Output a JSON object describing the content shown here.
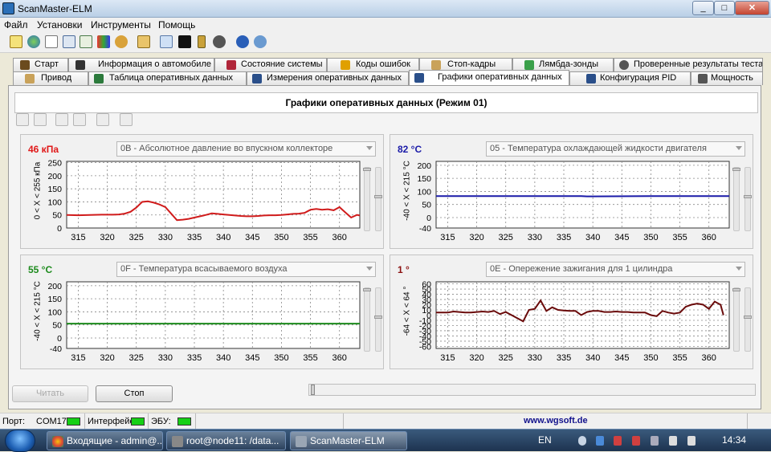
{
  "window": {
    "title": "ScanMaster-ELM",
    "min": "_",
    "max": "□",
    "close": "✕"
  },
  "menu": [
    "Файл",
    "Установки",
    "Инструменты",
    "Помощь"
  ],
  "toolbar_icons": [
    "connect-icon",
    "globe-icon",
    "document-icon",
    "grid-icon",
    "table-icon",
    "chart-icon",
    "settings-icon",
    "clipboard-icon",
    "chat-icon",
    "terminal-icon",
    "battery-icon",
    "record-icon",
    "info-icon",
    "help-icon"
  ],
  "tabs_row1": [
    {
      "label": "Старт",
      "icon_color": "#6b4b1e"
    },
    {
      "label": "Информация о автомобиле",
      "icon_color": "#333333"
    },
    {
      "label": "Состояние системы",
      "icon_color": "#b0263a"
    },
    {
      "label": "Коды ошибок",
      "icon_color": "#e0a000"
    },
    {
      "label": "Стоп-кадры",
      "icon_color": "#c9a25a"
    },
    {
      "label": "Лямбда-зонды",
      "icon_color": "#3aa04a"
    },
    {
      "label": "Проверенные результаты теста",
      "icon_color": "#555555"
    }
  ],
  "tabs_row2": [
    {
      "label": "Привод",
      "icon_color": "#c9a25a"
    },
    {
      "label": "Таблица оперативных данных",
      "icon_color": "#2c7a3c"
    },
    {
      "label": "Измерения оперативных данных",
      "icon_color": "#2a4f8a"
    },
    {
      "label": "Графики оперативных данных",
      "icon_color": "#2a4f8a"
    },
    {
      "label": "Конфигурация PID",
      "icon_color": "#2a4f8a"
    },
    {
      "label": "Мощность",
      "icon_color": "#555555"
    }
  ],
  "panel": {
    "title": "Графики оперативных данных (Режим 01)"
  },
  "panel_tools": [
    "add-graph-icon",
    "remove-graph-icon",
    "open-icon",
    "save-icon",
    "print-icon",
    "print-preview-icon"
  ],
  "graphs": [
    {
      "value": "46 кПа",
      "value_color": "#e01818",
      "pid": "0B - Абсолютное давление во впускном коллекторе",
      "unit": "0  < X <  255 кПа",
      "line_color": "#d01c1c",
      "y_ticks": [
        250,
        200,
        150,
        100,
        50,
        0
      ],
      "ymin": 0,
      "ymax": 255,
      "x_ticks": [
        315,
        320,
        325,
        330,
        335,
        340,
        345,
        350,
        355,
        360
      ],
      "x": [
        313,
        315,
        317,
        319,
        321,
        322,
        323,
        324,
        325,
        326,
        327,
        328,
        329,
        330,
        331,
        332,
        333,
        334,
        335,
        336,
        337,
        338,
        339,
        340,
        341,
        342,
        343,
        344,
        345,
        346,
        347,
        348,
        349,
        350,
        351,
        352,
        353,
        354,
        355,
        356,
        357,
        358,
        359,
        360,
        361,
        362,
        363,
        363.5
      ],
      "y": [
        50,
        49,
        50,
        51,
        51,
        52,
        55,
        62,
        78,
        100,
        102,
        97,
        90,
        80,
        55,
        30,
        32,
        35,
        40,
        45,
        50,
        56,
        54,
        52,
        50,
        48,
        46,
        45,
        45,
        46,
        48,
        49,
        49,
        50,
        52,
        54,
        55,
        58,
        70,
        73,
        70,
        72,
        68,
        80,
        60,
        40,
        50,
        48
      ]
    },
    {
      "value": "82 °C",
      "value_color": "#1a1aa8",
      "pid": "05 - Температура охлаждающей жидкости двигателя",
      "unit": "-40  < X <  215 °C",
      "line_color": "#1a1aa8",
      "y_ticks": [
        200,
        150,
        100,
        50,
        0,
        -40
      ],
      "ymin": -40,
      "ymax": 215,
      "x_ticks": [
        315,
        320,
        325,
        330,
        335,
        340,
        345,
        350,
        355,
        360
      ],
      "x": [
        313,
        320,
        330,
        338,
        339,
        340,
        350,
        360,
        363.5
      ],
      "y": [
        82,
        82,
        82,
        82,
        81,
        81,
        82,
        82,
        82
      ]
    },
    {
      "value": "55 °C",
      "value_color": "#1c8a1c",
      "pid": "0F - Температура всасываемого воздуха",
      "unit": "-40  < X <  215 °C",
      "line_color": "#1c8a1c",
      "y_ticks": [
        200,
        150,
        100,
        50,
        0,
        -40
      ],
      "ymin": -40,
      "ymax": 215,
      "x_ticks": [
        315,
        320,
        325,
        330,
        335,
        340,
        345,
        350,
        355,
        360
      ],
      "x": [
        313,
        330,
        350,
        363.5
      ],
      "y": [
        55,
        55,
        55,
        55
      ]
    },
    {
      "value": "1 °",
      "value_color": "#8b1010",
      "pid": "0E - Опережение зажигания для 1 цилиндра",
      "unit": "-64  < X <  64 °",
      "line_color": "#6a0a0a",
      "y_ticks": [
        60,
        50,
        40,
        30,
        20,
        10,
        0,
        -10,
        -20,
        -30,
        -40,
        -50,
        -60
      ],
      "ymin": -64,
      "ymax": 64,
      "x_ticks": [
        315,
        320,
        325,
        330,
        335,
        340,
        345,
        350,
        355,
        360
      ],
      "x": [
        313,
        315,
        316,
        317,
        318,
        319,
        320,
        321,
        322,
        323,
        324,
        325,
        326,
        327,
        328,
        329,
        330,
        331,
        332,
        333,
        334,
        335,
        336,
        337,
        338,
        339,
        340,
        341,
        342,
        343,
        344,
        345,
        346,
        347,
        348,
        349,
        350,
        351,
        352,
        353,
        354,
        355,
        356,
        357,
        358,
        359,
        360,
        361,
        362,
        362.5
      ],
      "y": [
        5,
        5,
        7,
        6,
        5,
        5,
        6,
        7,
        6,
        8,
        2,
        6,
        0,
        -6,
        -12,
        10,
        12,
        28,
        8,
        15,
        10,
        9,
        8,
        8,
        0,
        6,
        8,
        8,
        6,
        6,
        7,
        6,
        6,
        5,
        5,
        5,
        0,
        -2,
        8,
        5,
        3,
        5,
        16,
        20,
        22,
        20,
        12,
        26,
        20,
        0
      ]
    }
  ],
  "buttons": {
    "read": "Читать",
    "stop": "Стоп"
  },
  "status": {
    "port_label": "Порт:",
    "port": "COM17",
    "interface_label": "Интерфейс:",
    "ecu_label": "ЭБУ:",
    "url": "www.wgsoft.de"
  },
  "taskbar": {
    "tasks": [
      "Входящие - admin@...",
      "root@node11: /data...",
      "ScanMaster-ELM"
    ],
    "lang": "EN",
    "clock": "14:34"
  }
}
